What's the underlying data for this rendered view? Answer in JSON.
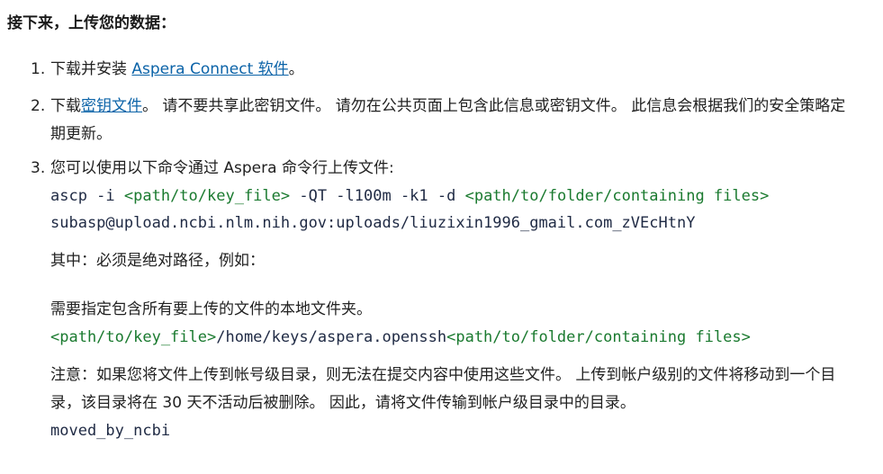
{
  "heading": "接下来，上传您的数据：",
  "steps": [
    {
      "num": "1.",
      "text_before": "下载并安装 ",
      "link": "Aspera Connect 软件",
      "text_after": "。"
    },
    {
      "num": "2.",
      "text_before": "下载",
      "link": "密钥文件",
      "text_after": "。 请不要共享此密钥文件。 请勿在公共页面上包含此信息或密钥文件。 此信息会根据我们的安全策略定期更新。"
    },
    {
      "num": "3.",
      "text": "您可以使用以下命令通过 Aspera 命令行上传文件:",
      "cmd": {
        "p1": "ascp -i ",
        "keyfile": "<path/to/key_file>",
        "p2": " -QT -l100m -k1 -d ",
        "folder": "<path/to/folder/containing files>",
        "line2": "subasp@upload.ncbi.nlm.nih.gov:uploads/liuzixin1996_gmail.com_zVEcHtnY"
      },
      "where_text": "其中：必须是绝对路径，例如：",
      "folder_note": "需要指定包含所有要上传的文件的本地文件夹。",
      "example": {
        "keyfile": "<path/to/key_file>",
        "keypath": "/home/keys/aspera.openssh",
        "folder": "<path/to/folder/containing files>"
      },
      "note": "注意：如果您将文件上传到帐号级目录，则无法在提交内容中使用这些文件。 上传到帐户级别的文件将移动到一个目录，该目录将在 30 天不活动后被删除。 因此，请将文件传输到帐户级目录中的目录。",
      "moved": "moved_by_ncbi"
    }
  ],
  "colors": {
    "link": "#0b63a8",
    "code_highlight": "#1a7a2f",
    "code_text": "#1f2a44"
  }
}
